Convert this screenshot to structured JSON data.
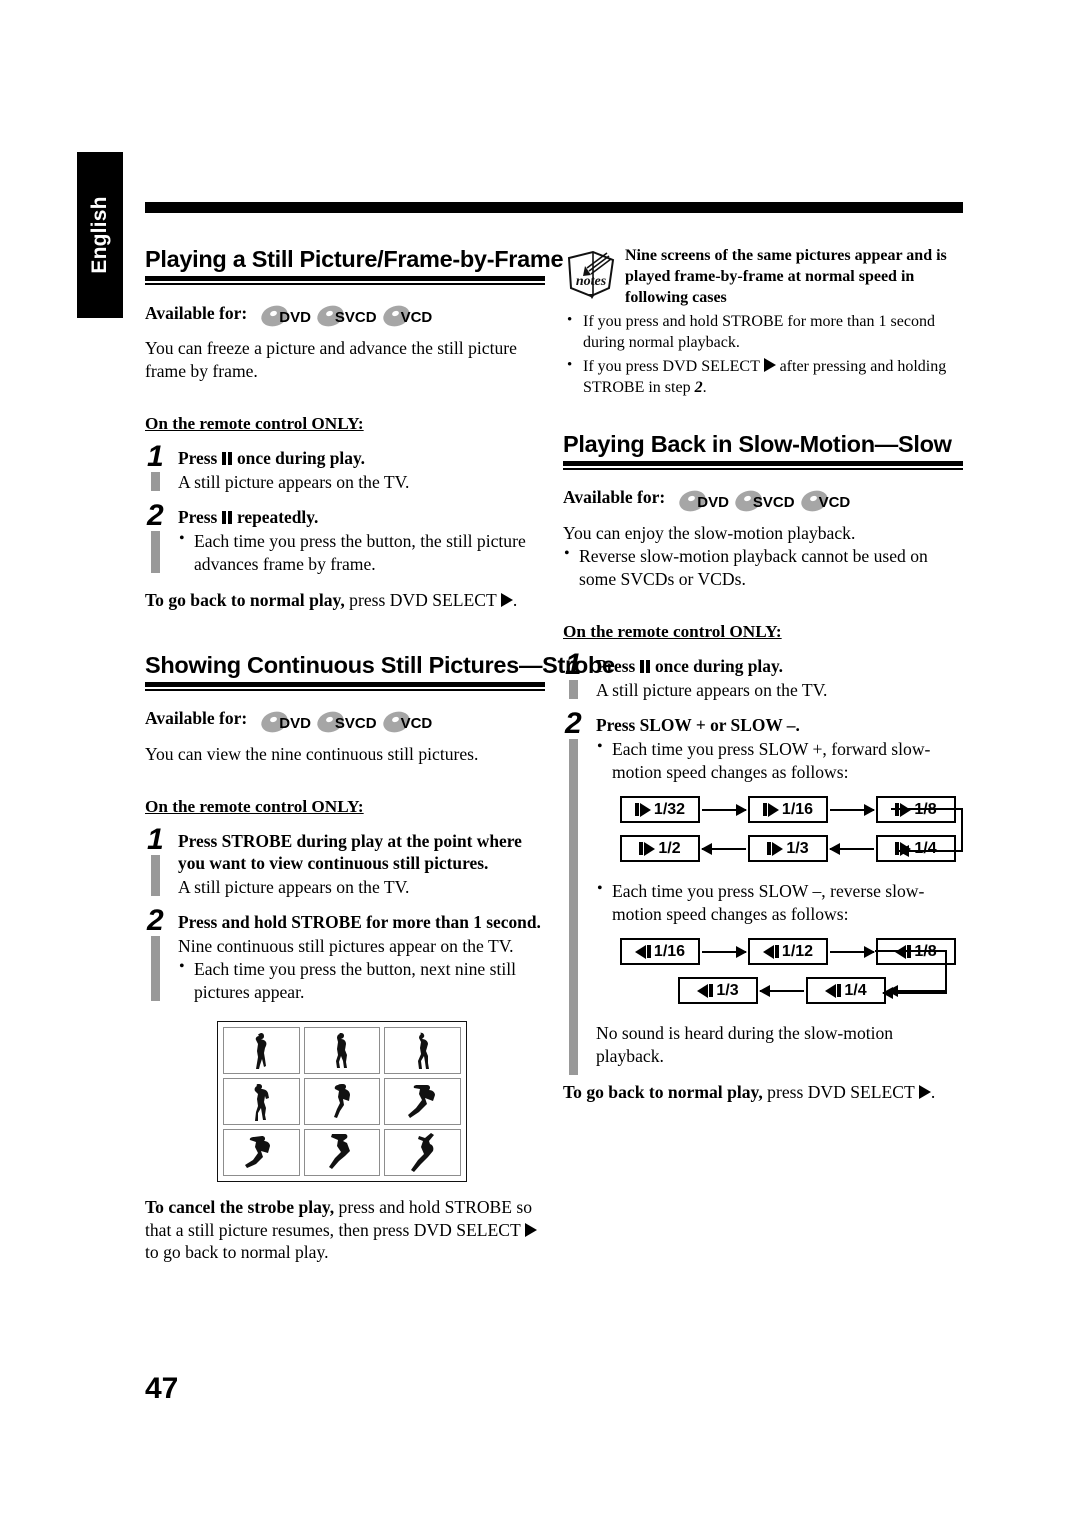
{
  "page": {
    "language_tab": "English",
    "page_number": "47"
  },
  "left_column": {
    "section1": {
      "heading": "Playing a Still Picture/Frame-by-Frame",
      "available_label": "Available for:",
      "discs": [
        "DVD",
        "SVCD",
        "VCD"
      ],
      "intro": "You can freeze a picture and advance the still picture frame by frame.",
      "remote_only": "On the remote control ONLY:",
      "steps": [
        {
          "number": "1",
          "title_pre": "Press ",
          "title_post": " once during play.",
          "sub": "A still picture appears on the TV.",
          "bullets": []
        },
        {
          "number": "2",
          "title_pre": "Press ",
          "title_post": " repeatedly.",
          "sub": "",
          "bullets": [
            "Each time you press the button, the still picture advances frame by frame."
          ]
        }
      ],
      "tail_bold": "To go back to normal play,",
      "tail_rest_pre": " press DVD SELECT ",
      "tail_rest_post": "."
    },
    "section2": {
      "heading": "Showing Continuous Still Pictures—Strobe",
      "available_label": "Available for:",
      "discs": [
        "DVD",
        "SVCD",
        "VCD"
      ],
      "intro": "You can view the nine continuous still pictures.",
      "remote_only": "On the remote control ONLY:",
      "steps": [
        {
          "number": "1",
          "title": "Press STROBE during play at the point where you want to view continuous still pictures.",
          "sub": "A still picture appears on the TV.",
          "bullets": []
        },
        {
          "number": "2",
          "title": "Press and hold STROBE for more than 1 second.",
          "sub": "Nine continuous still pictures appear on the TV.",
          "bullets": [
            "Each time you press the button, next nine still pictures appear."
          ]
        }
      ],
      "strobe_grid": {
        "caption_alt": "nine-still-pictures-of-baseball-pitcher",
        "rows": 3,
        "cols": 3,
        "frames": [
          "pitcher-windup-1",
          "pitcher-windup-2",
          "pitcher-leg-lift",
          "pitcher-stride-1",
          "pitcher-stride-2",
          "pitcher-arm-back",
          "pitcher-release-1",
          "pitcher-release-2",
          "pitcher-follow-through"
        ]
      },
      "tail_bold": "To cancel the strobe play,",
      "tail_rest_pre": " press and hold STROBE so that a still picture resumes, then press DVD SELECT ",
      "tail_rest_post": " to go back to normal play."
    }
  },
  "right_column": {
    "notes": {
      "icon_label": "notes",
      "headline": "Nine screens of the same pictures appear and is played frame-by-frame at normal speed in following cases",
      "bullets": [
        {
          "pre": "If you press and hold STROBE for more than 1 second during normal playback.",
          "post": ""
        },
        {
          "pre": "If you press DVD SELECT ",
          "mid": " after pressing and holding STROBE in step ",
          "step": "2",
          "post": "."
        }
      ]
    },
    "section3": {
      "heading": "Playing Back in Slow-Motion—Slow",
      "available_label": "Available for:",
      "discs": [
        "DVD",
        "SVCD",
        "VCD"
      ],
      "intro": "You can enjoy the slow-motion playback.",
      "intro_bullets": [
        "Reverse slow-motion playback cannot be used on some SVCDs or VCDs."
      ],
      "remote_only": "On the remote control ONLY:",
      "steps": [
        {
          "number": "1",
          "title_pre": "Press ",
          "title_post": " once during play.",
          "sub": "A still picture appears on the TV.",
          "bullets": []
        },
        {
          "number": "2",
          "title": "Press SLOW + or  SLOW –.",
          "bullets_forward": [
            "Each time you press SLOW +, forward slow-motion speed changes as follows:"
          ],
          "bullets_reverse": [
            "Each time you press SLOW –, reverse slow-motion speed changes as follows:"
          ]
        }
      ],
      "forward_flow": {
        "direction": "forward",
        "icon": "pause-play-forward-icon",
        "row1": [
          "1/32",
          "1/16",
          " 1/8"
        ],
        "row2": [
          " 1/2",
          " 1/3",
          " 1/4"
        ],
        "order": [
          "1/32",
          "1/16",
          "1/8",
          "1/4",
          "1/3",
          "1/2"
        ]
      },
      "reverse_flow": {
        "direction": "reverse",
        "icon": "reverse-play-pause-icon",
        "row1": [
          "1/16",
          "1/12",
          " 1/8"
        ],
        "row2": [
          " 1/3",
          " 1/4"
        ],
        "order": [
          "1/16",
          "1/12",
          "1/8",
          "1/4",
          "1/3"
        ]
      },
      "no_sound_note": "No sound is heard during the slow-motion playback.",
      "tail_bold": "To go back to normal play,",
      "tail_rest_pre": " press DVD SELECT ",
      "tail_rest_post": "."
    }
  }
}
